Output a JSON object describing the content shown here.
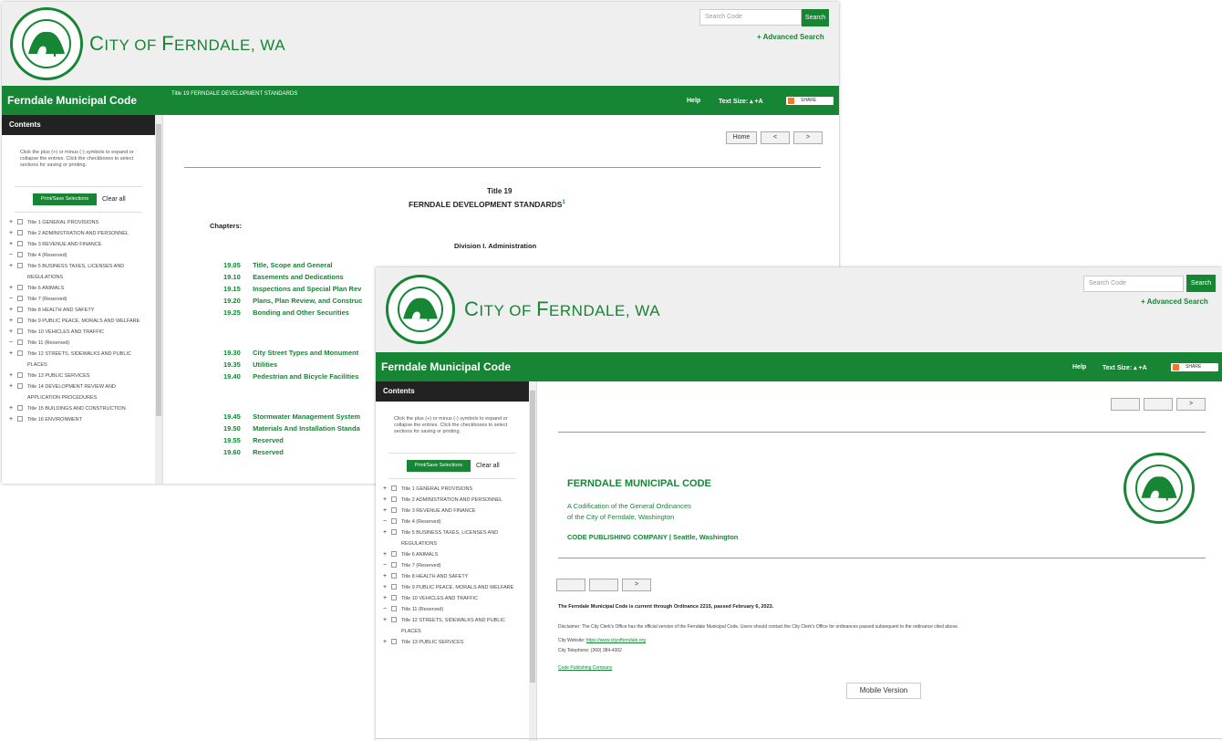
{
  "back": {
    "site_title_first": "C",
    "site_title_ity": "ITY OF ",
    "site_title_F": "F",
    "site_title_rest": "ERNDALE, WA",
    "seal_top": "CITY OF FERNDALE",
    "seal_bottom": "WASHINGTON",
    "search_placeholder": "Search Code",
    "search_button": "Search",
    "advanced_search": "+ Advanced Search",
    "brand": "Ferndale Municipal Code",
    "breadcrumb": "Title 19 FERNDALE DEVELOPMENT STANDARDS",
    "help": "Help",
    "text_size": "Text Size: ▴ +A",
    "share": "SHARE",
    "contents": "Contents",
    "instructions": "Click the plus (+) or minus (-) symbols to expand or collapse the entries. Click the checkboxes to select sections for saving or printing.",
    "print_save": "Print/Save Selections",
    "clear_all": "Clear all",
    "nav_home": "Home",
    "nav_prev": "<",
    "nav_next": ">",
    "title_num": "Title 19",
    "title_name": "FERNDALE DEVELOPMENT STANDARDS",
    "title_fn": "1",
    "chapters_label": "Chapters:",
    "division": "Division I. Administration",
    "toc": [
      {
        "pm": "+",
        "label": "Title 1 GENERAL PROVISIONS"
      },
      {
        "pm": "+",
        "label": "Title 2 ADMINISTRATION AND PERSONNEL"
      },
      {
        "pm": "+",
        "label": "Title 3 REVENUE AND FINANCE"
      },
      {
        "pm": "−",
        "label": "Title 4 (Reserved)"
      },
      {
        "pm": "+",
        "label": "Title 5 BUSINESS TAXES, LICENSES AND REGULATIONS"
      },
      {
        "pm": "+",
        "label": "Title 6 ANIMALS"
      },
      {
        "pm": "−",
        "label": "Title 7 (Reserved)"
      },
      {
        "pm": "+",
        "label": "Title 8 HEALTH AND SAFETY"
      },
      {
        "pm": "+",
        "label": "Title 9 PUBLIC PEACE, MORALS AND WELFARE"
      },
      {
        "pm": "+",
        "label": "Title 10 VEHICLES AND TRAFFIC"
      },
      {
        "pm": "−",
        "label": "Title 11 (Reserved)"
      },
      {
        "pm": "+",
        "label": "Title 12 STREETS, SIDEWALKS AND PUBLIC PLACES"
      },
      {
        "pm": "+",
        "label": "Title 13 PUBLIC SERVICES"
      },
      {
        "pm": "+",
        "label": "Title 14 DEVELOPMENT REVIEW AND APPLICATION PROCEDURES"
      },
      {
        "pm": "+",
        "label": "Title 15 BUILDINGS AND CONSTRUCTION"
      },
      {
        "pm": "+",
        "label": "Title 16 ENVIRONMENT"
      }
    ],
    "chapters": [
      {
        "num": "19.05",
        "name": "Title, Scope and General"
      },
      {
        "num": "19.10",
        "name": "Easements and Dedications"
      },
      {
        "num": "19.15",
        "name": "Inspections and Special Plan Rev"
      },
      {
        "num": "19.20",
        "name": "Plans, Plan Review, and Construc"
      },
      {
        "num": "19.25",
        "name": "Bonding and Other Securities"
      },
      {
        "num": "19.30",
        "name": "City Street Types and Monument"
      },
      {
        "num": "19.35",
        "name": "Utilities"
      },
      {
        "num": "19.40",
        "name": "Pedestrian and Bicycle Facilities"
      },
      {
        "num": "19.45",
        "name": "Stormwater Management System"
      },
      {
        "num": "19.50",
        "name": "Materials And Installation Standa"
      },
      {
        "num": "19.55",
        "name": "Reserved"
      },
      {
        "num": "19.60",
        "name": "Reserved"
      }
    ]
  },
  "front": {
    "site_title_first": "C",
    "site_title_ity": "ITY OF ",
    "site_title_F": "F",
    "site_title_rest": "ERNDALE, WA",
    "seal_top": "CITY OF FERNDALE",
    "seal_bottom": "WASHINGTON",
    "search_placeholder": "Search Code",
    "search_button": "Search",
    "advanced_search": "+ Advanced Search",
    "brand": "Ferndale Municipal Code",
    "help": "Help",
    "text_size": "Text Size: ▴ +A",
    "share": "SHARE",
    "contents": "Contents",
    "instructions": "Click the plus (+) or minus (-) symbols to expand or collapse the entries. Click the checkboxes to select sections for saving or printing.",
    "print_save": "Print/Save Selections",
    "clear_all": "Clear all",
    "nav_next": ">",
    "code_title": "FERNDALE MUNICIPAL CODE",
    "codification_1": "A Codification of the General Ordinances",
    "codification_2": "of the City of Ferndale, Washington",
    "publisher": "CODE PUBLISHING COMPANY | Seattle, Washington",
    "current_through": "The Ferndale Municipal Code is current through Ordinance 2215, passed February 6, 2023.",
    "disclaimer": "Disclaimer: The City Clerk's Office has the official version of the Ferndale Municipal Code. Users should contact the City Clerk's Office for ordinances passed subsequent to the ordinance cited above.",
    "city_website_label": "City Website:",
    "city_website_url": "https://www.cityofferndale.org",
    "city_phone": "City Telephone: (360) 384-4302",
    "code_publishing_link": "Code Publishing Company",
    "mobile_version": "Mobile Version",
    "toc": [
      {
        "pm": "+",
        "label": "Title 1 GENERAL PROVISIONS"
      },
      {
        "pm": "+",
        "label": "Title 2 ADMINISTRATION AND PERSONNEL"
      },
      {
        "pm": "+",
        "label": "Title 3 REVENUE AND FINANCE"
      },
      {
        "pm": "−",
        "label": "Title 4 (Reserved)"
      },
      {
        "pm": "+",
        "label": "Title 5 BUSINESS TAXES, LICENSES AND REGULATIONS"
      },
      {
        "pm": "+",
        "label": "Title 6 ANIMALS"
      },
      {
        "pm": "−",
        "label": "Title 7 (Reserved)"
      },
      {
        "pm": "+",
        "label": "Title 8 HEALTH AND SAFETY"
      },
      {
        "pm": "+",
        "label": "Title 9 PUBLIC PEACE, MORALS AND WELFARE"
      },
      {
        "pm": "+",
        "label": "Title 10 VEHICLES AND TRAFFIC"
      },
      {
        "pm": "−",
        "label": "Title 11 (Reserved)"
      },
      {
        "pm": "+",
        "label": "Title 12 STREETS, SIDEWALKS AND PUBLIC PLACES"
      },
      {
        "pm": "+",
        "label": "Title 13 PUBLIC SERVICES"
      }
    ]
  }
}
